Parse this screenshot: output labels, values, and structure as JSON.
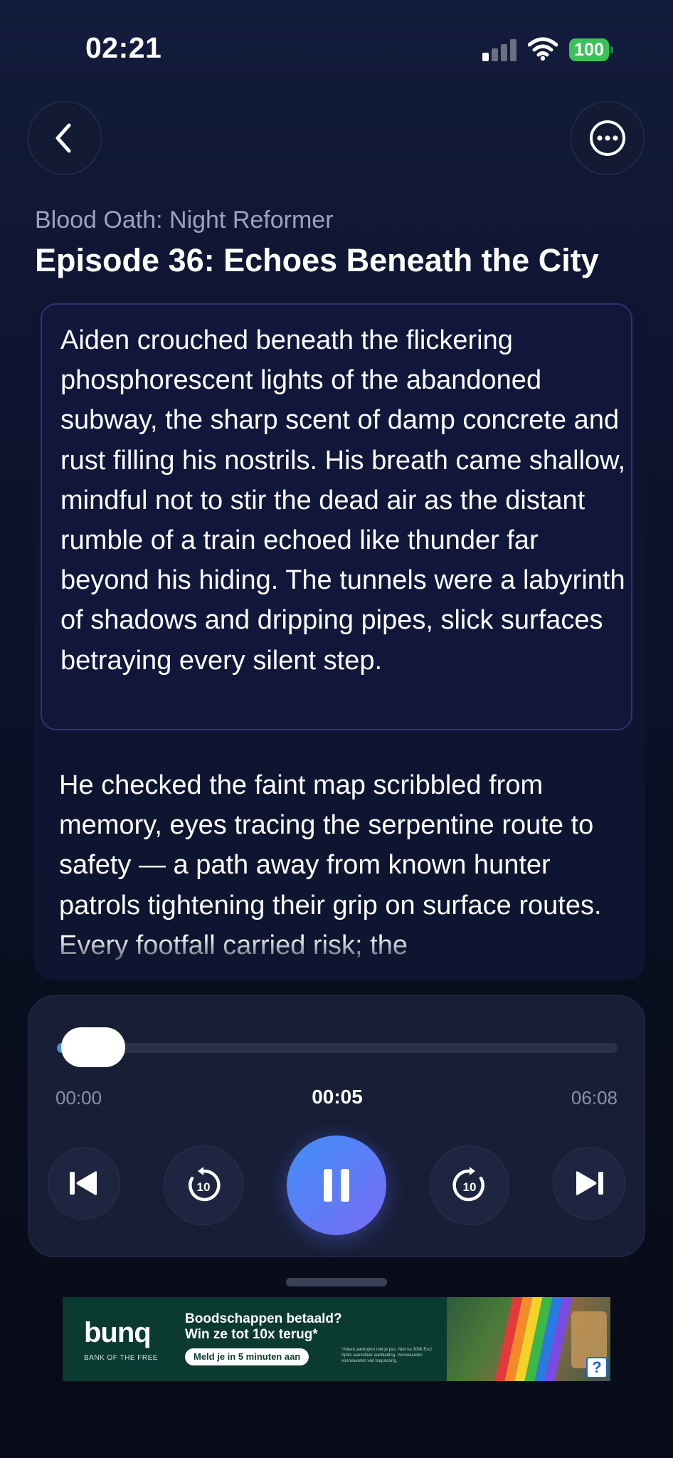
{
  "status_bar": {
    "time": "02:21",
    "battery": "100"
  },
  "header": {
    "series_title": "Blood Oath: Night Reformer",
    "episode_title": "Episode 36: Echoes Beneath the City"
  },
  "reader": {
    "paragraphs": [
      "Aiden crouched beneath the flickering phosphorescent lights of the abandoned subway, the sharp scent of damp concrete and rust filling his nostrils. His breath came shallow, mindful not to stir the dead air as the distant rumble of a train echoed like thunder far beyond his hiding. The tunnels were a labyrinth of shadows and dripping pipes, slick surfaces betraying every silent step.",
      "He checked the faint map scribbled from memory, eyes tracing the serpentine route to safety — a path away from known hunter patrols tightening their grip on surface routes. Every footfall carried risk; the"
    ]
  },
  "player": {
    "time_start": "00:00",
    "time_current": "00:05",
    "time_end": "06:08",
    "progress": 0.014,
    "rewind_seconds": "10",
    "forward_seconds": "10",
    "state": "playing"
  },
  "ad": {
    "brand": "bunq",
    "tagline": "BANK OF THE FREE",
    "headline_1": "Boodschappen betaald?",
    "headline_2": "Win ze tot 10x terug*",
    "cta": "Meld je in 5 minuten aan",
    "fine_print": "*Alleen aankopen met je pas. Niet na 300€ Excl. Splits aanvulleer aanbieding. Voorwaarden voorwaarden van toepassing.",
    "help": "?"
  },
  "colors": {
    "background": "#0b1128",
    "accent_start": "#3f8ff7",
    "accent_end": "#7a6cf4",
    "battery": "#3ac25a"
  }
}
